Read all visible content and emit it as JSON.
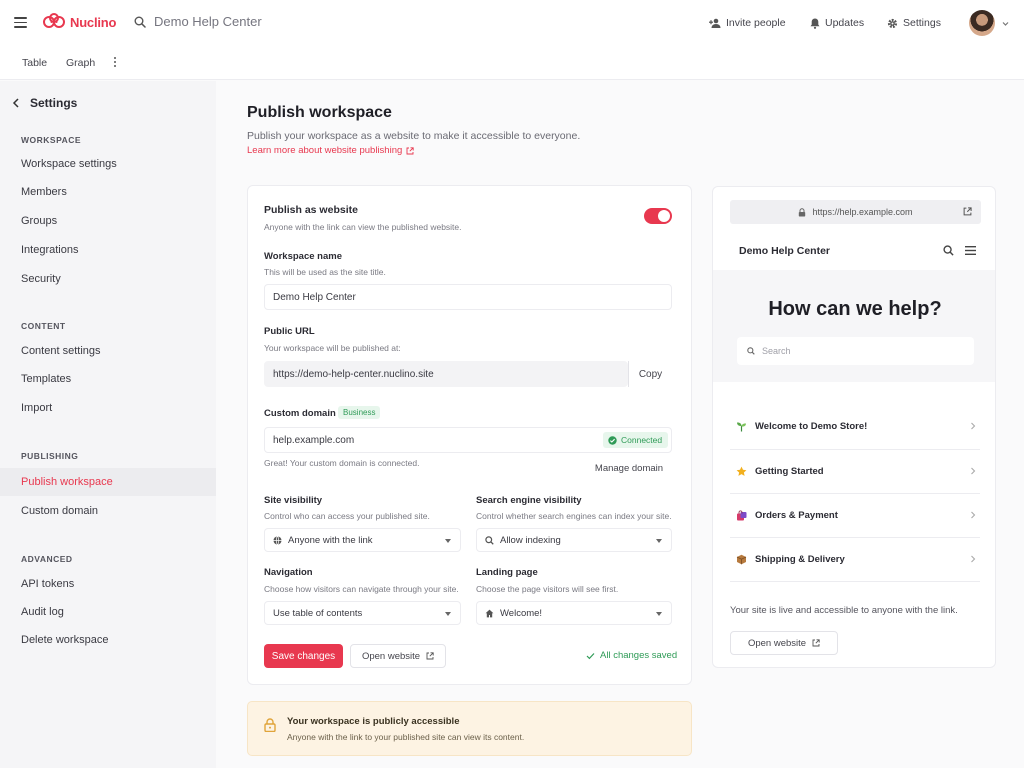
{
  "app": {
    "name": "Nuclino",
    "workspace_title": "Demo Help Center"
  },
  "topbar": {
    "invite": "Invite people",
    "updates": "Updates",
    "settings": "Settings"
  },
  "subnav": {
    "table": "Table",
    "graph": "Graph"
  },
  "sidebar": {
    "back_label": "Settings",
    "sections": {
      "workspace": "WORKSPACE",
      "content": "CONTENT",
      "publishing": "PUBLISHING",
      "advanced": "ADVANCED"
    },
    "items": {
      "workspace_settings": "Workspace settings",
      "members": "Members",
      "groups": "Groups",
      "integrations": "Integrations",
      "security": "Security",
      "content_settings": "Content settings",
      "templates": "Templates",
      "import": "Import",
      "publish_workspace": "Publish workspace",
      "custom_domain": "Custom domain",
      "api_tokens": "API tokens",
      "audit_log": "Audit log",
      "delete_workspace": "Delete workspace"
    },
    "active": "publish_workspace"
  },
  "main": {
    "title": "Publish workspace",
    "description": "Publish your workspace as a website to make it accessible to everyone.",
    "learn_more": "Learn more about website publishing"
  },
  "form": {
    "publish": {
      "label": "Publish as website",
      "hint": "Anyone with the link can view the published website.",
      "enabled": true
    },
    "workspace_name": {
      "label": "Workspace name",
      "hint": "This will be used as the site title.",
      "value": "Demo Help Center"
    },
    "public_url": {
      "label": "Public URL",
      "hint": "Your workspace will be published at:",
      "value": "https://demo-help-center.nuclino.site",
      "copy": "Copy"
    },
    "custom_domain": {
      "label": "Custom domain",
      "badge": "Business",
      "value": "help.example.com",
      "status": "Connected",
      "message": "Great! Your custom domain is connected.",
      "manage": "Manage domain"
    },
    "site_visibility": {
      "label": "Site visibility",
      "hint": "Control who can access your published site.",
      "value": "Anyone with the link"
    },
    "search_visibility": {
      "label": "Search engine visibility",
      "hint": "Control whether search engines can index your site.",
      "value": "Allow indexing"
    },
    "navigation": {
      "label": "Navigation",
      "hint": "Choose how visitors can navigate through your site.",
      "value": "Use table of contents"
    },
    "landing_page": {
      "label": "Landing page",
      "hint": "Choose the page visitors will see first.",
      "value": "Welcome!"
    },
    "save": "Save changes",
    "open_website": "Open website",
    "saved": "All changes saved"
  },
  "notice": {
    "title": "Your workspace is publicly accessible",
    "text": "Anyone with the link to your published site can view its content."
  },
  "preview": {
    "url": "https://help.example.com",
    "site_title": "Demo Help Center",
    "heading": "How can we help?",
    "search_placeholder": "Search",
    "items": [
      {
        "label": "Welcome to Demo Store!",
        "icon": "seedling-icon"
      },
      {
        "label": "Getting Started",
        "icon": "star-icon"
      },
      {
        "label": "Orders & Payment",
        "icon": "shopping-bag-icon"
      },
      {
        "label": "Shipping & Delivery",
        "icon": "package-icon"
      }
    ],
    "live_text": "Your site is live and accessible to anyone with the link.",
    "open_website": "Open website"
  },
  "colors": {
    "accent": "#e8384f",
    "success": "#2f9b57",
    "notice_bg": "#fdf3e3"
  }
}
